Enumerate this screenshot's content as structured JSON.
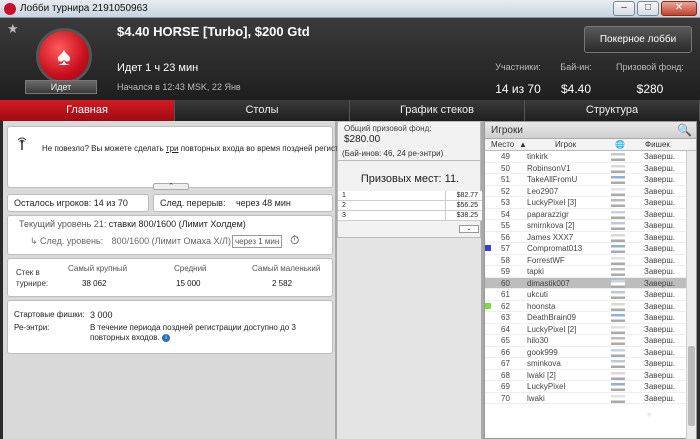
{
  "window": {
    "title": "Лобби турнира 2191050963",
    "min": "–",
    "max": "□",
    "close": "✕"
  },
  "header": {
    "tournament_name": "$4.40 HORSE [Turbo], $200 Gtd",
    "logo_status": "Идет",
    "runtime": "Идет 1 ч 23 мин",
    "started": "Начался в 12:43 MSK, 22 Янв",
    "poker_lobby_button": "Покерное лобби",
    "stats": [
      {
        "label": "Участники:",
        "value": "14 из 70"
      },
      {
        "label": "Бай-ин:",
        "value": "$4.40"
      },
      {
        "label": "Призовой фонд:",
        "value": "$280"
      }
    ]
  },
  "tabs": [
    "Главная",
    "Столы",
    "График стеков",
    "Структура"
  ],
  "active_tab": 0,
  "message": {
    "pre": "Не повезло? Вы можете сделать ",
    "link": "три",
    "post": " повторных входа во время поздней регистрации!",
    "collapse_icon": "⌃"
  },
  "players_left": {
    "label": "Осталось игроков:",
    "value": "14 из 70"
  },
  "next_break": {
    "label": "След. перерыв:",
    "value": "через 48 мин"
  },
  "level": {
    "current_label": "Текущий уровень 21:",
    "current_value": "ставки 800/1600 (Лимит Холдем)",
    "next_label": "След. уровень:",
    "next_value": "800/1600 (Лимит Омаха Х/Л)",
    "next_time": "через 1 мин"
  },
  "stacks": {
    "label": "Стек в турнире:",
    "largest_label": "Самый крупный",
    "largest": "38 062",
    "average_label": "Средний",
    "average": "15 000",
    "smallest_label": "Самый маленький",
    "smallest": "2 582"
  },
  "chips": {
    "start_label": "Стартовые фишки:",
    "start_value": "3 000",
    "reentry_label": "Ре-энтри:",
    "reentry_value": "В течение периода поздней регистрации доступно до 3 повторных входов."
  },
  "prize_pool": {
    "label": "Общий призовой фонд:",
    "value": "$280.00",
    "buyins": "(Бай-инов: 46, 24 ре-энтри)",
    "places": "Призовых мест: 11.",
    "expand_icon": "⌄",
    "prizes": [
      {
        "place": "1",
        "amount": "$82.77"
      },
      {
        "place": "2",
        "amount": "$56.25"
      },
      {
        "place": "3",
        "amount": "$38.25"
      }
    ]
  },
  "players": {
    "title": "Игроки",
    "col_rank": "Место",
    "col_player": "Игрок",
    "col_chips": "Фишек",
    "rows": [
      {
        "rank": "49",
        "name": "tinkirk",
        "status": "Заверш."
      },
      {
        "rank": "50",
        "name": "RobinsonV1",
        "status": "Заверш."
      },
      {
        "rank": "51",
        "name": "TakeAllFromU",
        "status": "Заверш."
      },
      {
        "rank": "52",
        "name": "Leo2907",
        "status": "Заверш."
      },
      {
        "rank": "53",
        "name": "LuckyPixel [3]",
        "status": "Заверш."
      },
      {
        "rank": "54",
        "name": "paparazzigr",
        "status": "Заверш."
      },
      {
        "rank": "55",
        "name": "smirnkova [2]",
        "status": "Заверш."
      },
      {
        "rank": "56",
        "name": "James XXX7",
        "status": "Заверш."
      },
      {
        "rank": "57",
        "name": "Compromat013",
        "status": "Заверш."
      },
      {
        "rank": "58",
        "name": "ForrestWF",
        "status": "Заверш."
      },
      {
        "rank": "59",
        "name": "tapki",
        "status": "Заверш."
      },
      {
        "rank": "60",
        "name": "dimastik007",
        "status": "Заверш."
      },
      {
        "rank": "61",
        "name": "ukcuti",
        "status": "Заверш."
      },
      {
        "rank": "62",
        "name": "hoonsta",
        "status": "Заверш."
      },
      {
        "rank": "63",
        "name": "DeathBrain09",
        "status": "Заверш."
      },
      {
        "rank": "64",
        "name": "LuckyPixel [2]",
        "status": "Заверш."
      },
      {
        "rank": "65",
        "name": "hilo30",
        "status": "Заверш."
      },
      {
        "rank": "66",
        "name": "gook999",
        "status": "Заверш."
      },
      {
        "rank": "67",
        "name": "sminkova",
        "status": "Заверш."
      },
      {
        "rank": "68",
        "name": "lwaki [2]",
        "status": "Заверш."
      },
      {
        "rank": "69",
        "name": "LuckyPixel",
        "status": "Заверш."
      },
      {
        "rank": "70",
        "name": "lwaki",
        "status": "Заверш."
      }
    ]
  },
  "colors": {
    "accent_red": "#c8102e",
    "tab_active": "#d41b22",
    "marker_blue": "#3a3ad4",
    "marker_green": "#7ddc3a"
  }
}
